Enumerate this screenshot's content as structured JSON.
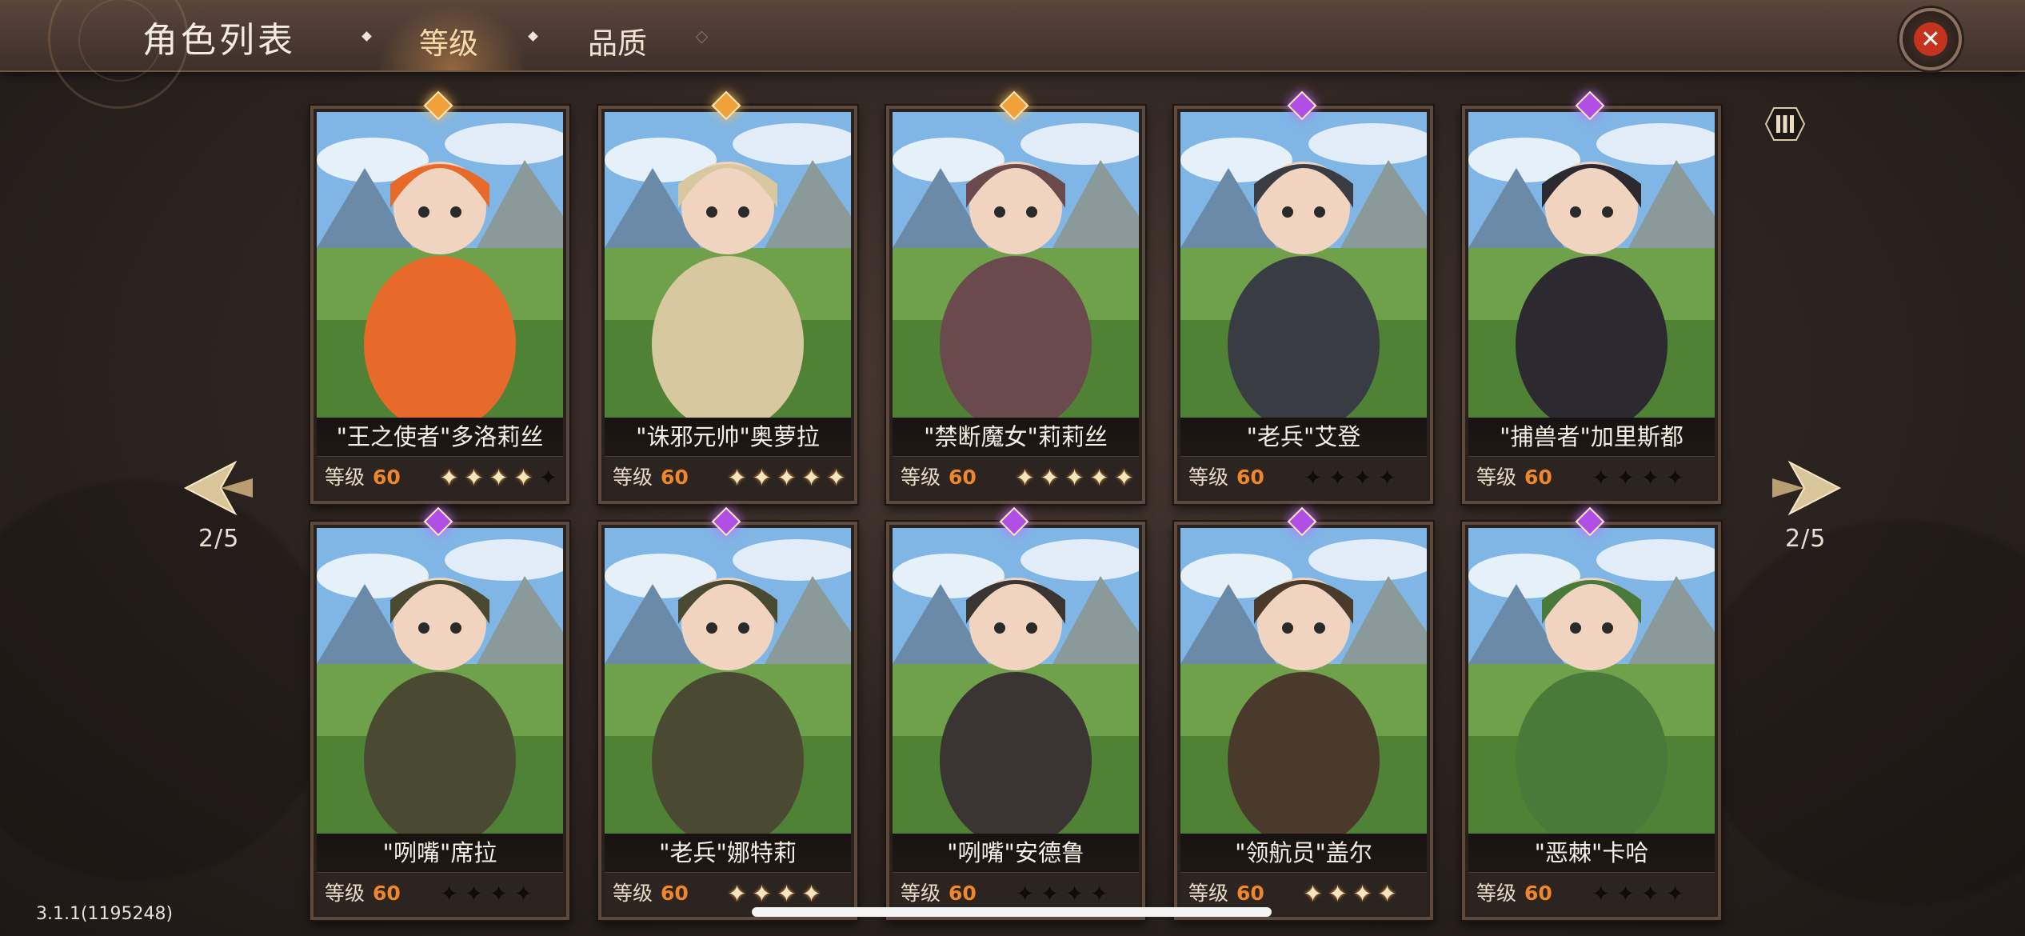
{
  "header": {
    "title": "角色列表",
    "tabs": [
      {
        "label": "等级",
        "active": true
      },
      {
        "label": "品质",
        "active": false
      }
    ],
    "close_icon": "close-x-icon"
  },
  "pagination": {
    "left_label": "2/5",
    "right_label": "2/5"
  },
  "level_label": "等级",
  "cards": [
    {
      "name": "\"王之使者\"多洛莉丝",
      "level": "60",
      "stars_total": 5,
      "stars_on": 4,
      "rarity": "gold",
      "bg": "#e86a2a"
    },
    {
      "name": "\"诛邪元帅\"奥萝拉",
      "level": "60",
      "stars_total": 5,
      "stars_on": 5,
      "rarity": "gold",
      "bg": "#d8c8a0"
    },
    {
      "name": "\"禁断魔女\"莉莉丝",
      "level": "60",
      "stars_total": 5,
      "stars_on": 5,
      "rarity": "gold",
      "bg": "#6b4a4e"
    },
    {
      "name": "\"老兵\"艾登",
      "level": "60",
      "stars_total": 4,
      "stars_on": 0,
      "rarity": "purple",
      "bg": "#3a3c44"
    },
    {
      "name": "\"捕兽者\"加里斯都",
      "level": "60",
      "stars_total": 4,
      "stars_on": 0,
      "rarity": "purple",
      "bg": "#2c2a30"
    },
    {
      "name": "\"咧嘴\"席拉",
      "level": "60",
      "stars_total": 4,
      "stars_on": 0,
      "rarity": "purple",
      "bg": "#4a4a32"
    },
    {
      "name": "\"老兵\"娜特莉",
      "level": "60",
      "stars_total": 4,
      "stars_on": 4,
      "rarity": "purple",
      "bg": "#4a4a32"
    },
    {
      "name": "\"咧嘴\"安德鲁",
      "level": "60",
      "stars_total": 4,
      "stars_on": 0,
      "rarity": "purple",
      "bg": "#3a3432"
    },
    {
      "name": "\"领航员\"盖尔",
      "level": "60",
      "stars_total": 4,
      "stars_on": 4,
      "rarity": "purple",
      "bg": "#4a3a2c"
    },
    {
      "name": "\"恶棘\"卡哈",
      "level": "60",
      "stars_total": 4,
      "stars_on": 0,
      "rarity": "purple",
      "bg": "#4a7a3a"
    }
  ],
  "version": "3.1.1(1195248)",
  "colors": {
    "accent_level": "#f0862a",
    "rarity_gold": "#f0a23a",
    "rarity_purple": "#b04ee6",
    "close_red": "#c4331e"
  }
}
